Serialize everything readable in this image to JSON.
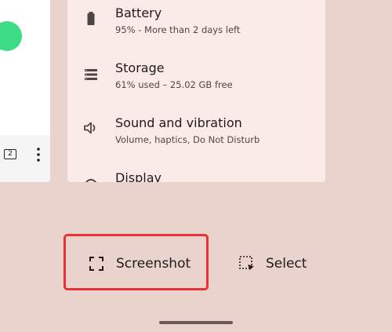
{
  "recent_app": {
    "tab_count": "2"
  },
  "settings": {
    "items": [
      {
        "title": "Battery",
        "subtitle": "95% - More than 2 days left",
        "icon": "battery-icon"
      },
      {
        "title": "Storage",
        "subtitle": "61% used – 25.02 GB free",
        "icon": "storage-icon"
      },
      {
        "title": "Sound and vibration",
        "subtitle": "Volume, haptics, Do Not Disturb",
        "icon": "sound-icon"
      },
      {
        "title": "Display",
        "subtitle": "",
        "icon": "display-icon"
      }
    ]
  },
  "actions": {
    "screenshot_label": "Screenshot",
    "select_label": "Select"
  },
  "colors": {
    "background": "#ead2cd",
    "card": "#fbebe8",
    "highlight": "#ee2f33",
    "accent_green": "#3ddc84"
  }
}
